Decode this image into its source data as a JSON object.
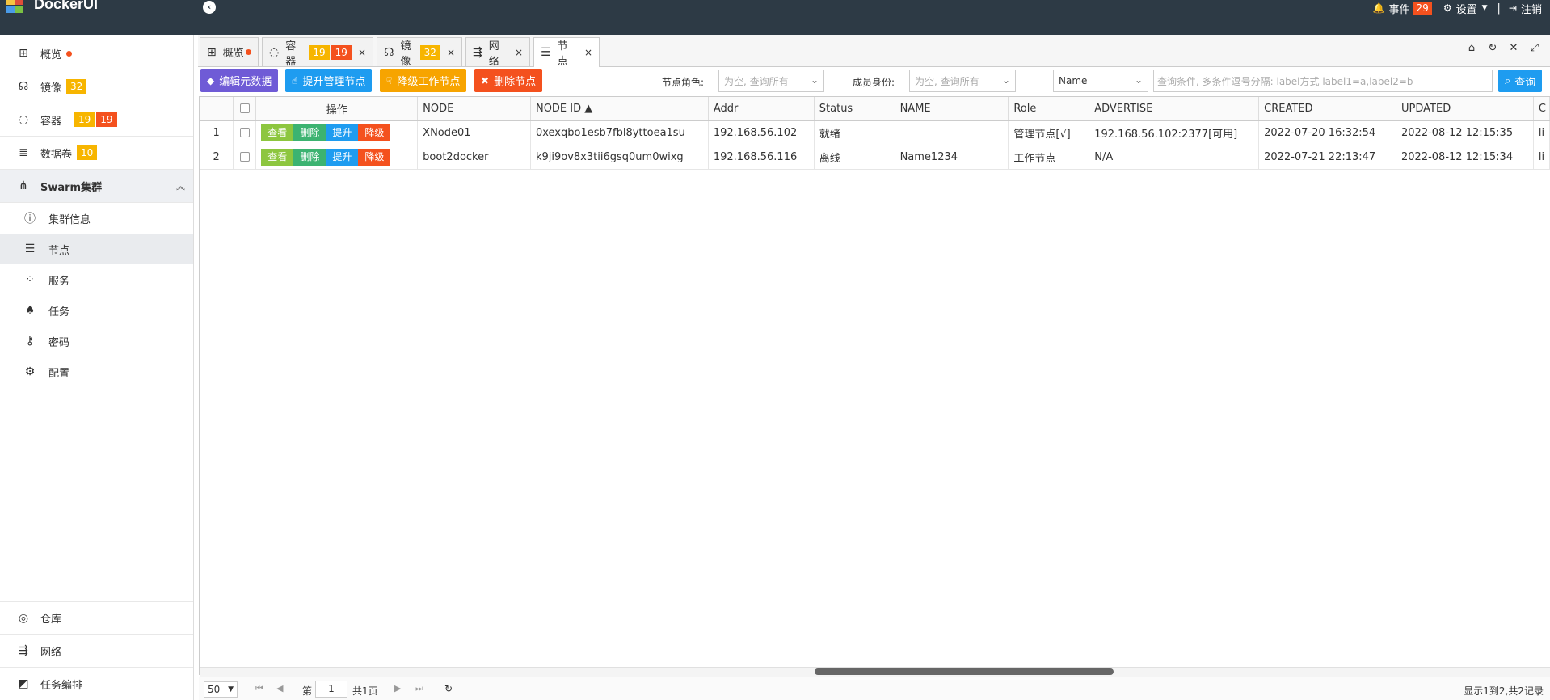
{
  "app": {
    "title": "DockerUI"
  },
  "topbar": {
    "events_label": "事件",
    "events_count": "29",
    "settings_label": "设置",
    "separator": "|",
    "logout_label": "注销"
  },
  "sidebar": {
    "overview": "概览",
    "images": "镜像",
    "images_count": "32",
    "containers": "容器",
    "containers_count_a": "19",
    "containers_count_b": "19",
    "volumes": "数据卷",
    "volumes_count": "10",
    "swarm": "Swarm集群",
    "swarm_items": {
      "info": "集群信息",
      "nodes": "节点",
      "services": "服务",
      "tasks": "任务",
      "secrets": "密码",
      "configs": "配置"
    },
    "registry": "仓库",
    "network": "网络",
    "compose": "任务编排"
  },
  "tabs": {
    "overview": "概览",
    "containers": "容器",
    "containers_a": "19",
    "containers_b": "19",
    "images": "镜像",
    "images_count": "32",
    "network": "网络",
    "nodes": "节点",
    "close": "×"
  },
  "toolbar": {
    "edit_meta": "编辑元数据",
    "promote": "提升管理节点",
    "demote": "降级工作节点",
    "delete": "删除节点",
    "role_label": "节点角色:",
    "role_placeholder": "为空, 查询所有",
    "member_label": "成员身份:",
    "member_placeholder": "为空, 查询所有",
    "field_select": "Name",
    "query_placeholder": "查询条件, 多条件逗号分隔: label方式 label1=a,label2=b",
    "query_button": "查询"
  },
  "table": {
    "headers": [
      "操作",
      "NODE",
      "NODE ID ▲",
      "Addr",
      "Status",
      "NAME",
      "Role",
      "ADVERTISE",
      "CREATED",
      "UPDATED",
      "C"
    ],
    "ops": {
      "view": "查看",
      "delete": "删除",
      "promote": "提升",
      "demote": "降级"
    },
    "rows": [
      {
        "num": "1",
        "node": "XNode01",
        "id": "0xexqbo1esb7fbl8yttoea1su",
        "addr": "192.168.56.102",
        "status": "就绪",
        "name": "",
        "role": "管理节点[√]",
        "advertise": "192.168.56.102:2377[可用]",
        "created": "2022-07-20 16:32:54",
        "updated": "2022-08-12 12:15:35",
        "c": "li"
      },
      {
        "num": "2",
        "node": "boot2docker",
        "id": "k9ji9ov8x3tii6gsq0um0wixg",
        "addr": "192.168.56.116",
        "status": "离线",
        "name": "Name1234",
        "role": "工作节点",
        "advertise": "N/A",
        "created": "2022-07-21 22:13:47",
        "updated": "2022-08-12 12:15:34",
        "c": "li"
      }
    ]
  },
  "pager": {
    "page_size": "50",
    "page_prefix": "第",
    "page_value": "1",
    "page_total": "共1页",
    "summary": "显示1到2,共2记录"
  },
  "colors": {
    "topbar": "#2d3a45",
    "purple": "#6f5bd6",
    "blue": "#1e9cf0",
    "orange": "#f7a400",
    "red": "#f4511e",
    "green": "#8dc63f"
  }
}
